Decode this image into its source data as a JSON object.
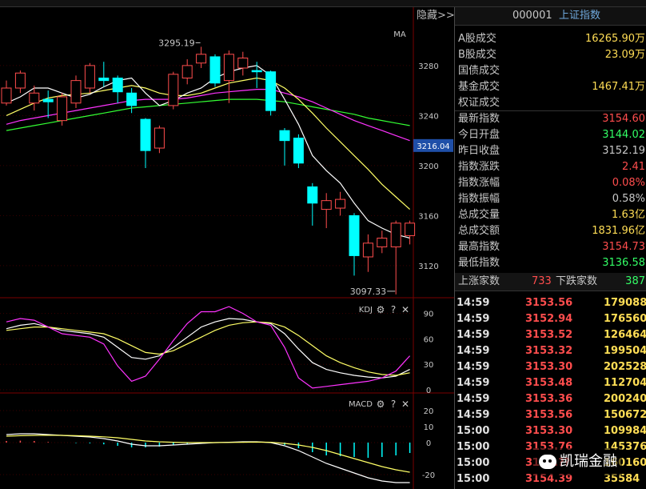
{
  "toolbar": {
    "hide_label": "隐藏>>"
  },
  "colors": {
    "up": "#ff4d4d",
    "down": "#00ffff",
    "ma5": "#ffffff",
    "ma10": "#ffff66",
    "ma20": "#ff33ff",
    "ma30": "#33ff33",
    "neutral": "#c8c8c8",
    "green": "#33ff66",
    "accent": "#6fa8dc"
  },
  "chart_data": [
    {
      "type": "candlestick",
      "indicator": "MA",
      "ylim": [
        3095,
        3310
      ],
      "ticks": [
        3120,
        3160,
        3200,
        3240,
        3280
      ],
      "current_price": "3216.04",
      "annotations": {
        "high": "3295.19",
        "low": "3097.33"
      },
      "candles": [
        {
          "o": 3250,
          "c": 3262,
          "h": 3268,
          "l": 3248
        },
        {
          "o": 3262,
          "c": 3274,
          "h": 3276,
          "l": 3258
        },
        {
          "o": 3250,
          "c": 3258,
          "h": 3264,
          "l": 3244
        },
        {
          "o": 3253,
          "c": 3251,
          "h": 3260,
          "l": 3238
        },
        {
          "o": 3236,
          "c": 3255,
          "h": 3258,
          "l": 3232
        },
        {
          "o": 3250,
          "c": 3268,
          "h": 3272,
          "l": 3246
        },
        {
          "o": 3262,
          "c": 3280,
          "h": 3282,
          "l": 3258
        },
        {
          "o": 3270,
          "c": 3268,
          "h": 3283,
          "l": 3263
        },
        {
          "o": 3270,
          "c": 3259,
          "h": 3272,
          "l": 3250
        },
        {
          "o": 3258,
          "c": 3248,
          "h": 3262,
          "l": 3242
        },
        {
          "o": 3237,
          "c": 3212,
          "h": 3238,
          "l": 3198
        },
        {
          "o": 3214,
          "c": 3230,
          "h": 3232,
          "l": 3210
        },
        {
          "o": 3248,
          "c": 3273,
          "h": 3275,
          "l": 3245
        },
        {
          "o": 3270,
          "c": 3280,
          "h": 3285,
          "l": 3265
        },
        {
          "o": 3282,
          "c": 3289,
          "h": 3295,
          "l": 3278
        },
        {
          "o": 3287,
          "c": 3266,
          "h": 3289,
          "l": 3263
        },
        {
          "o": 3268,
          "c": 3289,
          "h": 3292,
          "l": 3250
        },
        {
          "o": 3278,
          "c": 3286,
          "h": 3291,
          "l": 3272
        },
        {
          "o": 3276,
          "c": 3275,
          "h": 3283,
          "l": 3262
        },
        {
          "o": 3275,
          "c": 3244,
          "h": 3276,
          "l": 3240
        },
        {
          "o": 3228,
          "c": 3220,
          "h": 3230,
          "l": 3200
        },
        {
          "o": 3222,
          "c": 3202,
          "h": 3225,
          "l": 3198
        },
        {
          "o": 3183,
          "c": 3170,
          "h": 3186,
          "l": 3152
        },
        {
          "o": 3165,
          "c": 3172,
          "h": 3178,
          "l": 3150
        },
        {
          "o": 3166,
          "c": 3173,
          "h": 3179,
          "l": 3160
        },
        {
          "o": 3160,
          "c": 3128,
          "h": 3162,
          "l": 3112
        },
        {
          "o": 3127,
          "c": 3138,
          "h": 3145,
          "l": 3115
        },
        {
          "o": 3135,
          "c": 3142,
          "h": 3148,
          "l": 3130
        },
        {
          "o": 3135,
          "c": 3154,
          "h": 3156,
          "l": 3097
        },
        {
          "o": 3144,
          "c": 3154,
          "h": 3156,
          "l": 3137
        }
      ],
      "ma5": [
        3250,
        3255,
        3262,
        3262,
        3258,
        3254,
        3257,
        3263,
        3268,
        3270,
        3258,
        3248,
        3252,
        3258,
        3262,
        3270,
        3275,
        3278,
        3280,
        3272,
        3253,
        3233,
        3208,
        3196,
        3186,
        3170,
        3156,
        3150,
        3145,
        3142
      ],
      "ma10": [
        3240,
        3245,
        3250,
        3254,
        3256,
        3257,
        3258,
        3260,
        3262,
        3264,
        3262,
        3258,
        3256,
        3256,
        3258,
        3262,
        3266,
        3268,
        3270,
        3268,
        3262,
        3253,
        3242,
        3230,
        3219,
        3208,
        3197,
        3185,
        3175,
        3165
      ],
      "ma20": [
        3233,
        3236,
        3238,
        3240,
        3242,
        3244,
        3246,
        3248,
        3250,
        3252,
        3253,
        3253,
        3253,
        3254,
        3256,
        3258,
        3259,
        3260,
        3261,
        3261,
        3258,
        3255,
        3251,
        3246,
        3241,
        3236,
        3232,
        3228,
        3224,
        3220
      ],
      "ma30": [
        3228,
        3230,
        3232,
        3234,
        3236,
        3238,
        3240,
        3242,
        3244,
        3246,
        3247,
        3248,
        3249,
        3250,
        3251,
        3252,
        3253,
        3253,
        3253,
        3252,
        3251,
        3249,
        3247,
        3245,
        3243,
        3241,
        3238,
        3236,
        3234,
        3232
      ]
    },
    {
      "type": "line",
      "indicator": "KDJ",
      "ylim": [
        0,
        100
      ],
      "ticks": [
        0,
        30,
        60,
        90
      ],
      "series": [
        {
          "key": "K",
          "values": [
            72,
            76,
            78,
            74,
            70,
            68,
            66,
            62,
            50,
            38,
            36,
            40,
            50,
            62,
            74,
            80,
            84,
            83,
            80,
            78,
            66,
            48,
            32,
            24,
            20,
            17,
            15,
            14,
            16,
            24
          ]
        },
        {
          "key": "D",
          "values": [
            70,
            72,
            74,
            74,
            72,
            70,
            68,
            66,
            60,
            52,
            44,
            42,
            46,
            54,
            62,
            70,
            76,
            79,
            80,
            79,
            74,
            64,
            52,
            40,
            32,
            26,
            21,
            18,
            17,
            20
          ]
        },
        {
          "key": "J",
          "values": [
            80,
            84,
            82,
            74,
            66,
            64,
            62,
            54,
            28,
            10,
            16,
            36,
            58,
            78,
            92,
            92,
            98,
            90,
            80,
            76,
            50,
            14,
            2,
            4,
            6,
            8,
            10,
            14,
            22,
            40
          ]
        }
      ]
    },
    {
      "type": "line",
      "indicator": "MACD",
      "ylim": [
        -27,
        27
      ],
      "ticks": [
        -20,
        0,
        10,
        20
      ],
      "series": [
        {
          "key": "DIF",
          "values": [
            5,
            5.5,
            5.5,
            5,
            4.5,
            4,
            3.5,
            2.5,
            1,
            -1,
            -2,
            -2,
            -1.5,
            -1,
            -0.5,
            0,
            0.2,
            0.5,
            0.5,
            0,
            -2,
            -5,
            -9,
            -13,
            -16,
            -19,
            -22,
            -24,
            -25,
            -25
          ]
        },
        {
          "key": "DEA",
          "values": [
            4,
            4.3,
            4.5,
            4.6,
            4.5,
            4.3,
            4,
            3.6,
            3,
            2,
            1,
            0.5,
            0.2,
            0,
            0,
            0,
            0.1,
            0.2,
            0.3,
            0.2,
            -0.5,
            -1.5,
            -3,
            -5,
            -7.5,
            -10,
            -12.5,
            -15,
            -17,
            -18.5
          ]
        }
      ],
      "histogram": [
        1,
        1.2,
        1,
        0.4,
        0,
        -0.3,
        -0.5,
        -1.1,
        -2,
        -3,
        -3,
        -2.5,
        -1.7,
        -1,
        -0.5,
        0,
        0.1,
        0.3,
        0.2,
        -0.2,
        -1.5,
        -3.5,
        -6,
        -8,
        -8.5,
        -9,
        -9.5,
        -9,
        -8,
        -6.5
      ]
    }
  ],
  "panels": {
    "kdj_label": "KDJ",
    "macd_label": "MACD",
    "gear": "⚙",
    "help": "?",
    "close": "✕"
  },
  "quote": {
    "code": "000001",
    "name": "上证指数",
    "stats": [
      {
        "label": "A股成交",
        "value": "16265.90万",
        "color": "#ffdd55"
      },
      {
        "label": "B股成交",
        "value": "23.09万",
        "color": "#ffdd55"
      },
      {
        "label": "国债成交",
        "value": "",
        "color": "#ffdd55"
      },
      {
        "label": "基金成交",
        "value": "1467.41万",
        "color": "#ffdd55"
      },
      {
        "label": "权证成交",
        "value": "",
        "color": "#ffdd55"
      },
      {
        "label": "最新指数",
        "value": "3154.60",
        "color": "#ff4d4d"
      },
      {
        "label": "今日开盘",
        "value": "3144.02",
        "color": "#33ff66"
      },
      {
        "label": "昨日收盘",
        "value": "3152.19",
        "color": "#c8c8c8"
      },
      {
        "label": "指数涨跌",
        "value": "2.41",
        "color": "#ff4d4d"
      },
      {
        "label": "指数涨幅",
        "value": "0.08%",
        "color": "#ff4d4d"
      },
      {
        "label": "指数振幅",
        "value": "0.58%",
        "color": "#c8c8c8"
      },
      {
        "label": "总成交量",
        "value": "1.63亿",
        "color": "#ffdd55"
      },
      {
        "label": "总成交额",
        "value": "1831.96亿",
        "color": "#ffdd55"
      },
      {
        "label": "最高指数",
        "value": "3154.73",
        "color": "#ff4d4d"
      },
      {
        "label": "最低指数",
        "value": "3136.58",
        "color": "#33ff66"
      }
    ],
    "advance_label": "上涨家数",
    "advance_value": "733",
    "decline_label": "下跌家数",
    "decline_value": "387"
  },
  "ticks": [
    {
      "time": "14:59",
      "price": "3153.56",
      "vol": "179088"
    },
    {
      "time": "14:59",
      "price": "3152.94",
      "vol": "176560"
    },
    {
      "time": "14:59",
      "price": "3153.52",
      "vol": "126464"
    },
    {
      "time": "14:59",
      "price": "3153.32",
      "vol": "199504"
    },
    {
      "time": "14:59",
      "price": "3153.30",
      "vol": "202528"
    },
    {
      "time": "14:59",
      "price": "3153.48",
      "vol": "112704"
    },
    {
      "time": "14:59",
      "price": "3153.36",
      "vol": "200240"
    },
    {
      "time": "14:59",
      "price": "3153.56",
      "vol": "150672"
    },
    {
      "time": "15:00",
      "price": "3153.30",
      "vol": "109984"
    },
    {
      "time": "15:00",
      "price": "3153.76",
      "vol": "145376"
    },
    {
      "time": "15:00",
      "price": "3153.??",
      "vol": "160160"
    },
    {
      "time": "15:00",
      "price": "3154.39",
      "vol": "35584"
    }
  ],
  "watermark": {
    "text": "凯瑞金融",
    "icon": "wechat-icon"
  }
}
